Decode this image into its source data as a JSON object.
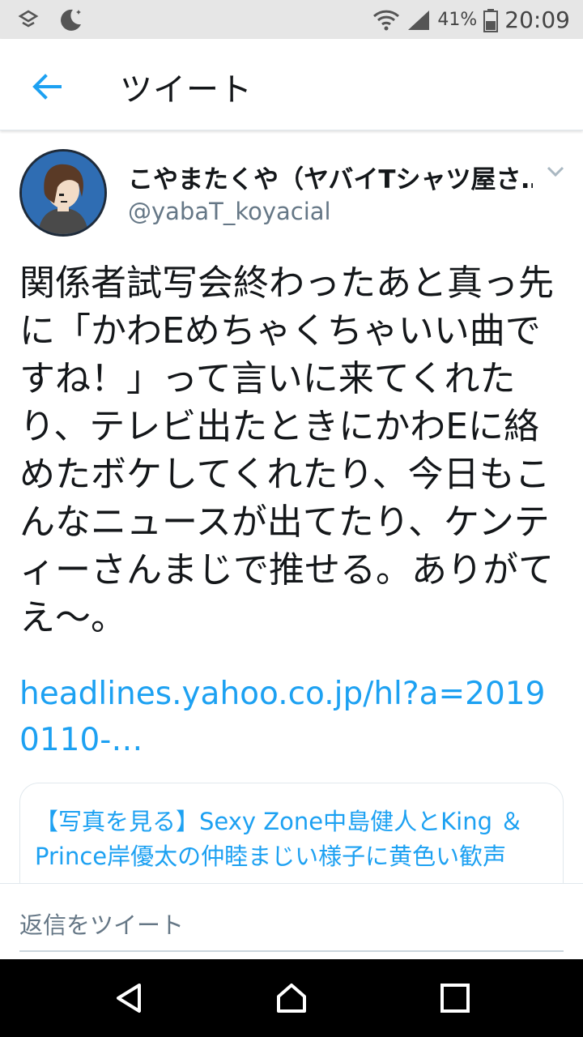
{
  "status": {
    "battery_pct": "41%",
    "time": "20:09"
  },
  "header": {
    "title": "ツイート"
  },
  "tweet": {
    "author_name": "こやまたくや（ヤバイTシャツ屋さ…",
    "author_handle": "@yabaT_koyacial",
    "text": "関係者試写会終わったあと真っ先に「かわEめちゃくちゃいい曲ですね！」って言いに来てくれたり、テレビ出たときにかわEに絡めたボケしてくれたり、今日もこんなニュースが出てたり、ケンティーさんまじで推せる。ありがてえ〜。",
    "link": "headlines.yahoo.co.jp/hl?a=20190110-…",
    "card_title": "【写真を見る】Sexy Zone中島健人とKing ＆ Prince岸優太の仲睦まじい様子に黄色い歓声"
  },
  "reply": {
    "placeholder": "返信をツイート"
  },
  "icons": {
    "back": "arrow-left-icon",
    "caret": "chevron-down-icon",
    "nav": [
      "back-triangle-icon",
      "home-icon",
      "recents-icon"
    ]
  },
  "colors": {
    "accent": "#1da1f2",
    "text": "#14171a",
    "secondary": "#657786"
  }
}
